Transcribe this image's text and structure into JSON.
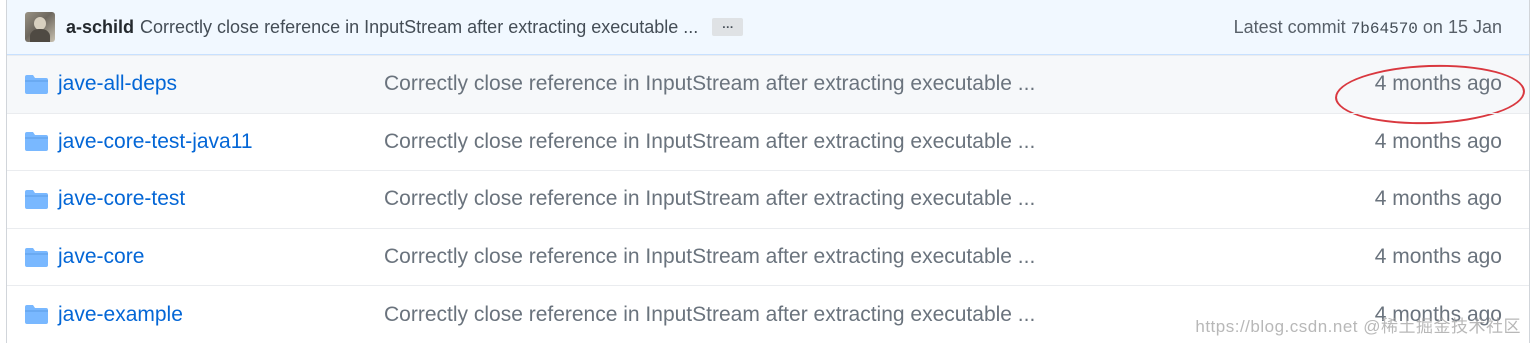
{
  "commit_bar": {
    "author": "a-schild",
    "message": "Correctly close reference in InputStream after extracting executable ...",
    "ellipsis": "…",
    "latest_label": "Latest commit",
    "sha": "7b64570",
    "date_text": "on 15 Jan"
  },
  "rows": [
    {
      "name": "jave-all-deps",
      "message": "Correctly close reference in InputStream after extracting executable ...",
      "age": "4 months ago"
    },
    {
      "name": "jave-core-test-java11",
      "message": "Correctly close reference in InputStream after extracting executable ...",
      "age": "4 months ago"
    },
    {
      "name": "jave-core-test",
      "message": "Correctly close reference in InputStream after extracting executable ...",
      "age": "4 months ago"
    },
    {
      "name": "jave-core",
      "message": "Correctly close reference in InputStream after extracting executable ...",
      "age": "4 months ago"
    },
    {
      "name": "jave-example",
      "message": "Correctly close reference in InputStream after extracting executable ...",
      "age": "4 months ago"
    }
  ],
  "watermark": "https://blog.csdn.net @稀土掘金技术社区",
  "colors": {
    "link": "#0366d6",
    "muted": "#6a737d",
    "folder": "#79b8ff",
    "annotation": "#d9383f",
    "commit_bar_bg": "#f1f8ff"
  },
  "icons": {
    "folder": "folder-icon"
  }
}
